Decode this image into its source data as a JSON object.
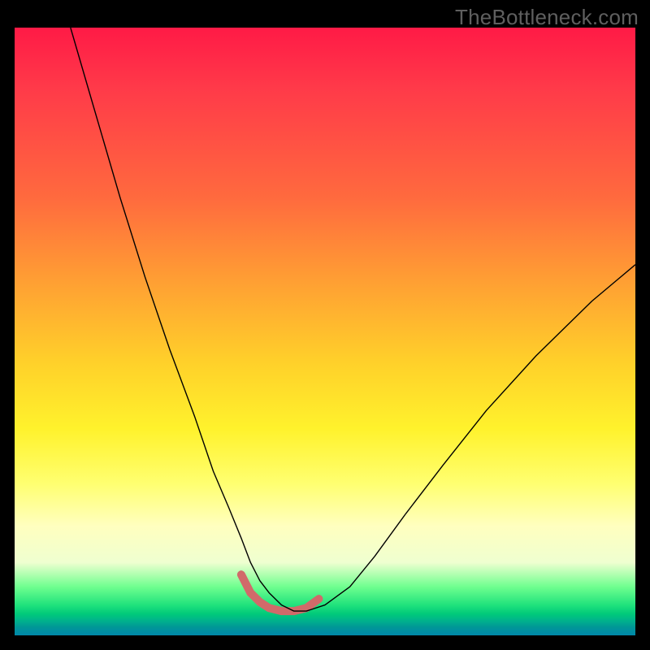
{
  "watermark": {
    "text": "TheBottleneck.com"
  },
  "chart_data": {
    "type": "line",
    "title": "",
    "xlabel": "",
    "ylabel": "",
    "xlim": [
      0,
      100
    ],
    "ylim": [
      0,
      100
    ],
    "legend": false,
    "grid": false,
    "background": {
      "type": "vertical-gradient",
      "stops": [
        {
          "pos": 0,
          "color": "#ff1a46"
        },
        {
          "pos": 28,
          "color": "#ff6a3e"
        },
        {
          "pos": 55,
          "color": "#ffd02a"
        },
        {
          "pos": 75,
          "color": "#ffff70"
        },
        {
          "pos": 92,
          "color": "#6fff8f"
        },
        {
          "pos": 100,
          "color": "#0088a8"
        }
      ]
    },
    "series": [
      {
        "name": "bottleneck-curve-thin",
        "stroke": "#000000",
        "stroke_width": 1.4,
        "x": [
          9,
          13,
          17,
          21,
          25,
          29,
          32,
          34.5,
          36.5,
          38,
          39.5,
          41,
          43,
          45,
          47,
          50,
          54,
          58,
          63,
          69,
          76,
          84,
          93,
          100
        ],
        "y": [
          100,
          86,
          72,
          59,
          47,
          36,
          27,
          21,
          16,
          12,
          9,
          7,
          5,
          4,
          4,
          5,
          8,
          13,
          20,
          28,
          37,
          46,
          55,
          61
        ]
      },
      {
        "name": "bottleneck-curve-thick-highlight",
        "stroke": "#d16a6a",
        "stroke_width": 10,
        "linecap": "round",
        "x": [
          36.5,
          38,
          39.5,
          41,
          43,
          45,
          47,
          49
        ],
        "y": [
          10,
          7,
          5.5,
          4.5,
          4,
          4,
          4.5,
          6
        ]
      }
    ],
    "annotations": []
  }
}
